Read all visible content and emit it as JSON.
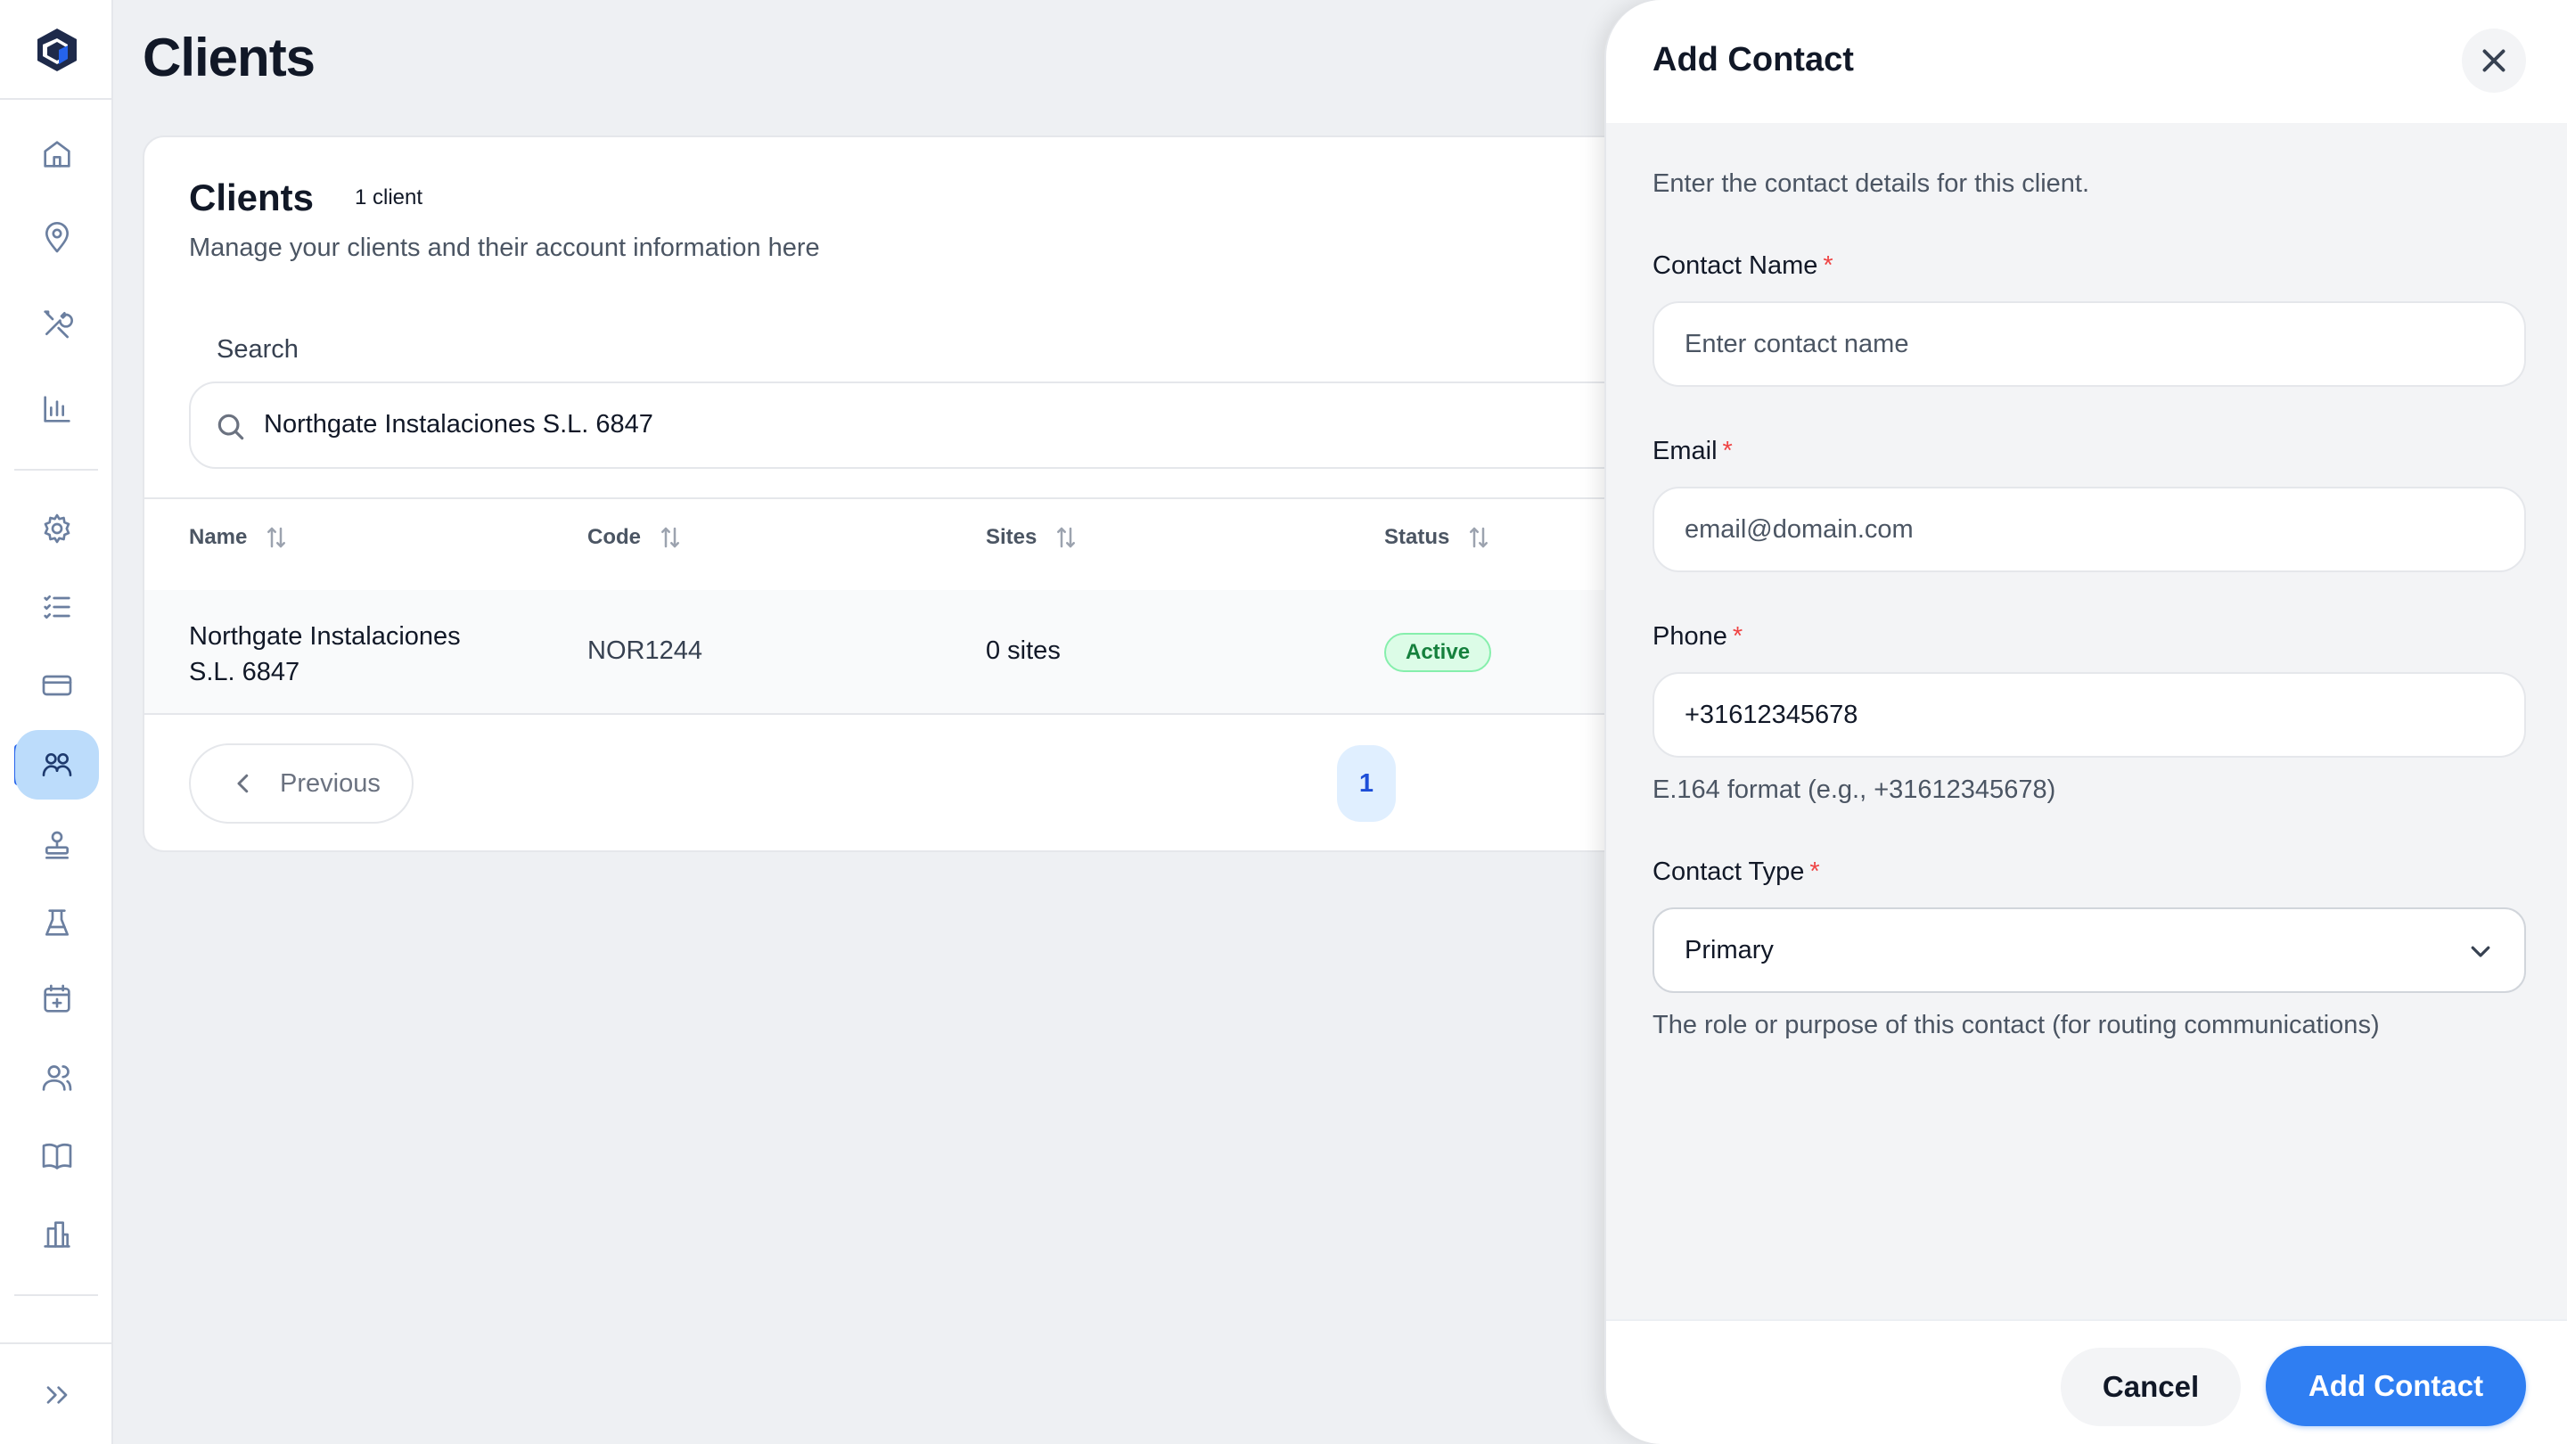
{
  "colors": {
    "accent": "#2f7ef2",
    "active_badge_bg": "#dcfce7",
    "active_badge_text": "#15803d",
    "required": "#ef4444",
    "sidebar_active": "#bcdcfb"
  },
  "sidebar": {
    "items": [
      {
        "icon": "home-icon"
      },
      {
        "icon": "map-pin-icon"
      },
      {
        "icon": "tools-icon"
      },
      {
        "icon": "bar-chart-icon"
      },
      {
        "icon": "settings-icon"
      },
      {
        "icon": "checklist-icon"
      },
      {
        "icon": "credit-card-icon"
      },
      {
        "icon": "clients-icon",
        "active": true
      },
      {
        "icon": "stamp-icon"
      },
      {
        "icon": "lab-flask-icon"
      },
      {
        "icon": "calendar-plus-icon"
      },
      {
        "icon": "users-icon"
      },
      {
        "icon": "book-icon"
      },
      {
        "icon": "building-icon"
      }
    ],
    "expand_icon": "chevrons-right-icon"
  },
  "header": {
    "title": "Clients"
  },
  "clients_card": {
    "title": "Clients",
    "count": "1 client",
    "description": "Manage your clients and their account information here",
    "search": {
      "label": "Search",
      "value": "Northgate Instalaciones S.L. 6847"
    },
    "columns": [
      "Name",
      "Code",
      "Sites",
      "Status"
    ],
    "rows": [
      {
        "name": "Northgate Instalaciones S.L. 6847",
        "code": "NOR1244",
        "sites": "0 sites",
        "status": "Active"
      }
    ],
    "pagination": {
      "previous_label": "Previous",
      "current_page": "1"
    }
  },
  "drawer": {
    "title": "Add Contact",
    "intro": "Enter the contact details for this client.",
    "required_mark": "*",
    "fields": {
      "contact_name": {
        "label": "Contact Name",
        "placeholder": "Enter contact name"
      },
      "email": {
        "label": "Email",
        "placeholder": "email@domain.com"
      },
      "phone": {
        "label": "Phone",
        "value": "+31612345678",
        "hint": "E.164 format (e.g., +31612345678)"
      },
      "contact_type": {
        "label": "Contact Type",
        "value": "Primary",
        "hint": "The role or purpose of this contact (for routing communications)"
      }
    },
    "cancel_label": "Cancel",
    "submit_label": "Add Contact"
  }
}
